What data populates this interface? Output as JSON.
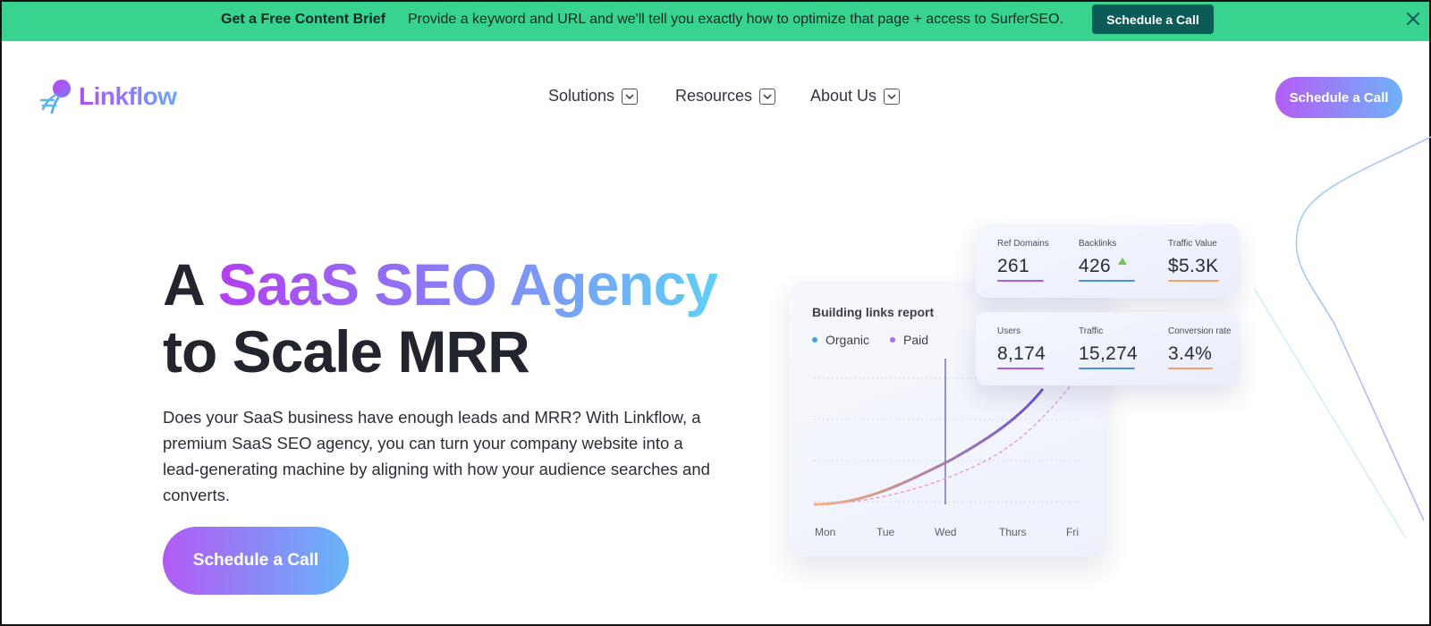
{
  "banner": {
    "bold": "Get a Free Content Brief",
    "text": "Provide a keyword and URL and we'll tell you exactly how to optimize that page + access to SurferSEO.",
    "button": "Schedule a Call",
    "close_icon": "close-icon"
  },
  "header": {
    "logo_text": "Linkflow",
    "logo_icon": "jellyfish-logo-icon",
    "nav": [
      {
        "label": "Solutions",
        "icon": "chevron-down-icon"
      },
      {
        "label": "Resources",
        "icon": "chevron-down-icon"
      },
      {
        "label": "About Us",
        "icon": "chevron-down-icon"
      }
    ],
    "cta": "Schedule a Call"
  },
  "hero": {
    "title_a": "A",
    "title_highlight": "SaaS SEO Agency",
    "title_line2": "to Scale MRR",
    "description": "Does your SaaS business have enough leads and MRR? With Linkflow, a premium SaaS SEO agency, you can turn your company website into a lead-generating machine by aligning with how your audience searches and converts.",
    "cta": "Schedule a Call"
  },
  "report": {
    "title": "Building links report",
    "legend": [
      {
        "label": "Organic",
        "color": "#3aa8e8"
      },
      {
        "label": "Paid",
        "color": "#a66ef0"
      }
    ],
    "days": [
      "Mon",
      "Tue",
      "Wed",
      "Thurs",
      "Fri"
    ]
  },
  "stats_top": [
    {
      "label": "Ref Domains",
      "value": "261",
      "color": "#a65ee9"
    },
    {
      "label": "Backlinks",
      "value": "426",
      "color": "#4a8fe6",
      "trend": "up-arrow-icon"
    },
    {
      "label": "Traffic Value",
      "value": "$5.3K",
      "color": "#f2a56a"
    }
  ],
  "stats_bottom": [
    {
      "label": "Users",
      "value": "8,174",
      "color": "#a65ee9"
    },
    {
      "label": "Traffic",
      "value": "15,274",
      "color": "#4a8fe6"
    },
    {
      "label": "Conversion rate",
      "value": "3.4%",
      "color": "#f2a56a"
    }
  ],
  "colors": {
    "banner_bg": "#38d38f",
    "banner_button": "#0b5b59",
    "brand_purple": "#b14ff4",
    "brand_blue": "#6aa7f7"
  }
}
